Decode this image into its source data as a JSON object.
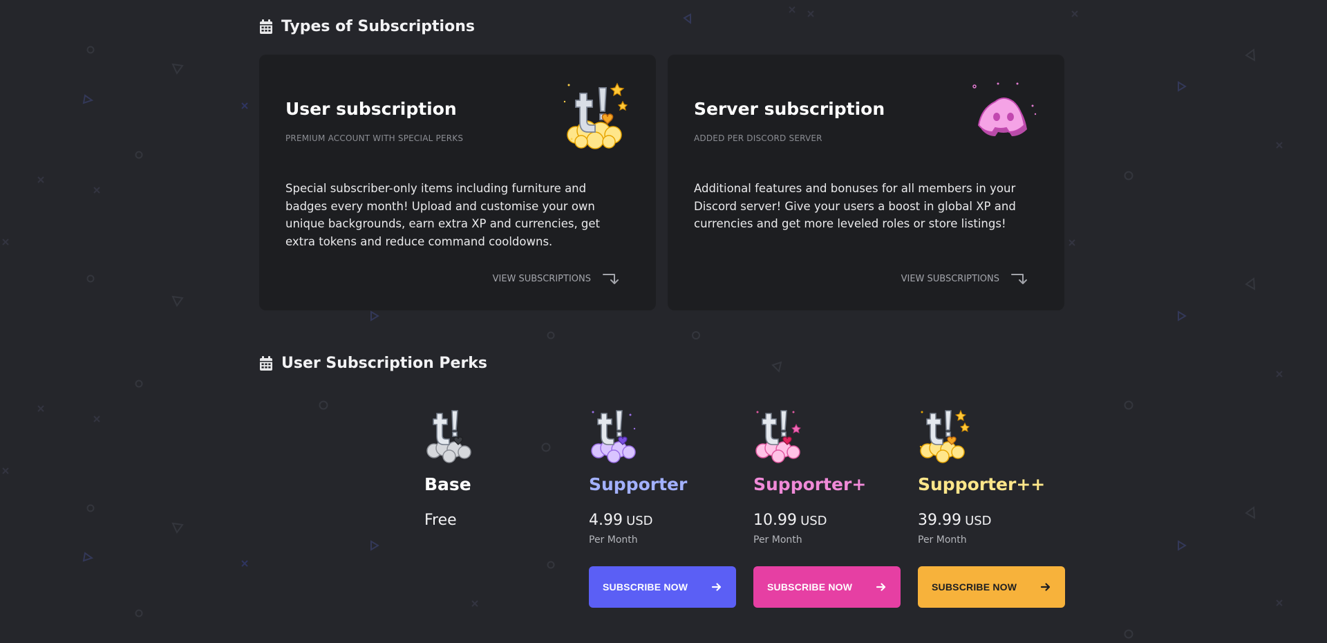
{
  "colors": {
    "background": "#25262b",
    "card": "#1d1e21",
    "supporter": "#a3b1ff",
    "supporter_plus": "#f08ad8",
    "supporter_plus_plus": "#fde68a",
    "btn_supporter": "#5b5ff5",
    "btn_supporter_plus": "#e63fa3",
    "btn_supporter_plus_plus": "#f7b23b"
  },
  "types_section": {
    "title": "Types of Subscriptions",
    "icon": "calendar-icon",
    "cards": [
      {
        "title": "User subscription",
        "subtitle": "PREMIUM ACCOUNT WITH SPECIAL PERKS",
        "description": "Special subscriber-only items including furniture and badges every month! Upload and customise your own unique backgrounds, earn extra XP and currencies, get extra tokens and reduce command cooldowns.",
        "link": "VIEW SUBSCRIPTIONS",
        "icon": "golden-cloud-t-icon"
      },
      {
        "title": "Server subscription",
        "subtitle": "ADDED PER DISCORD SERVER",
        "description": "Additional features and bonuses for all members in your Discord server! Give your users a boost in global XP and currencies and get more leveled roles or store listings!",
        "link": "VIEW SUBSCRIPTIONS",
        "icon": "pink-discord-icon"
      }
    ]
  },
  "perks_section": {
    "title": "User Subscription Perks",
    "icon": "calendar-icon",
    "tiers": [
      {
        "name": "Base",
        "price_text": "Free",
        "icon": "gray-cloud-t-icon"
      },
      {
        "name": "Supporter",
        "price": "4.99",
        "currency": "USD",
        "period": "Per Month",
        "button": "SUBSCRIBE NOW",
        "icon": "purple-cloud-t-icon"
      },
      {
        "name": "Supporter+",
        "price": "10.99",
        "currency": "USD",
        "period": "Per Month",
        "button": "SUBSCRIBE NOW",
        "icon": "pink-cloud-t-icon"
      },
      {
        "name": "Supporter++",
        "price": "39.99",
        "currency": "USD",
        "period": "Per Month",
        "button": "SUBSCRIBE NOW",
        "icon": "golden-cloud-t-icon"
      }
    ]
  }
}
